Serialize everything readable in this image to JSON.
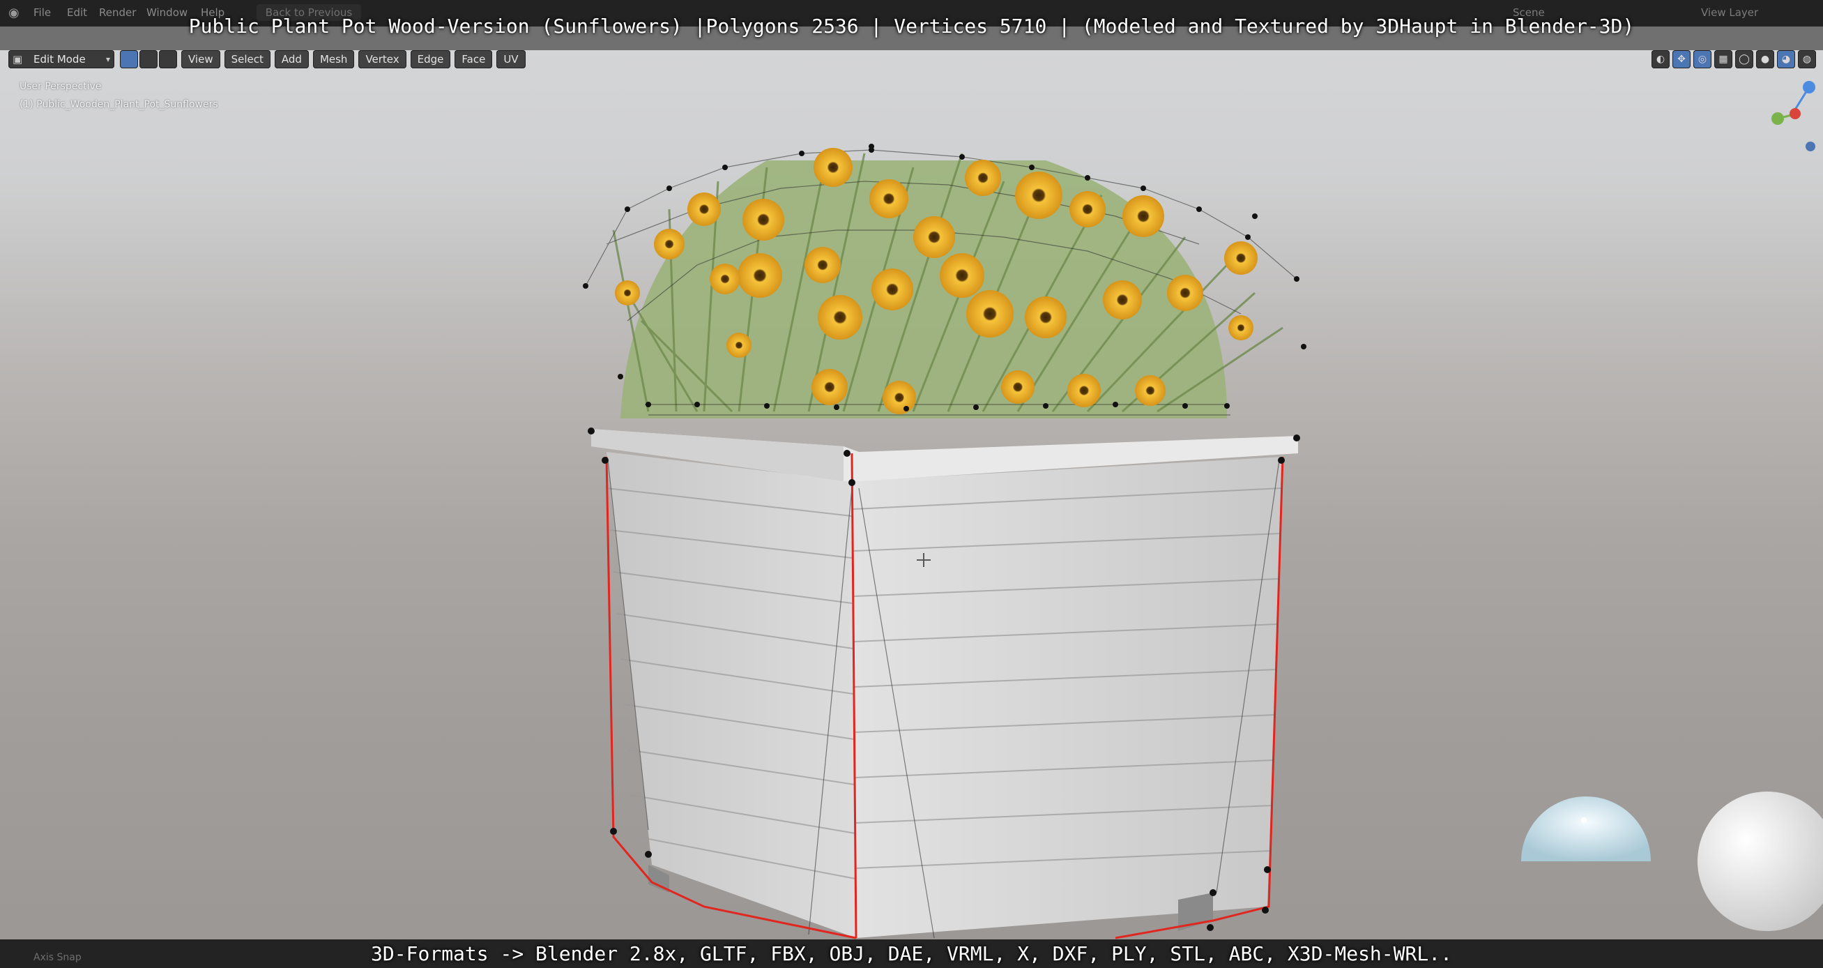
{
  "window": {
    "title_caption": "Public Plant Pot Wood-Version (Sunflowers) |Polygons 2536 | Vertices 5710 | (Modeled and Textured by 3DHaupt in Blender-3D)",
    "bottom_caption": "3D-Formats -> Blender 2.8x, GLTF, FBX, OBJ, DAE, VRML, X, DXF, PLY, STL, ABC, X3D-Mesh-WRL.."
  },
  "menubar": {
    "logo_icon": "blender-logo-icon",
    "items": [
      "File",
      "Edit",
      "Render",
      "Window",
      "Help"
    ],
    "back_label": "Back to Previous",
    "scene_label": "Scene",
    "view_layer_label": "View Layer"
  },
  "header": {
    "mode_label": "Edit Mode",
    "menus": [
      "View",
      "Select",
      "Add",
      "Mesh",
      "Vertex",
      "Edge",
      "Face",
      "UV"
    ]
  },
  "viewport": {
    "perspective_label": "User Perspective",
    "object_label": "(1) Public_Wooden_Plant_Pot_Sunflowers"
  },
  "statusbar": {
    "left_label": "Axis Snap"
  },
  "colors": {
    "accent": "#4b76b3",
    "edge_seam": "#e0261e",
    "petal": "#f0b21a",
    "stem": "#8da86a",
    "wood": "#d5d5d5"
  }
}
